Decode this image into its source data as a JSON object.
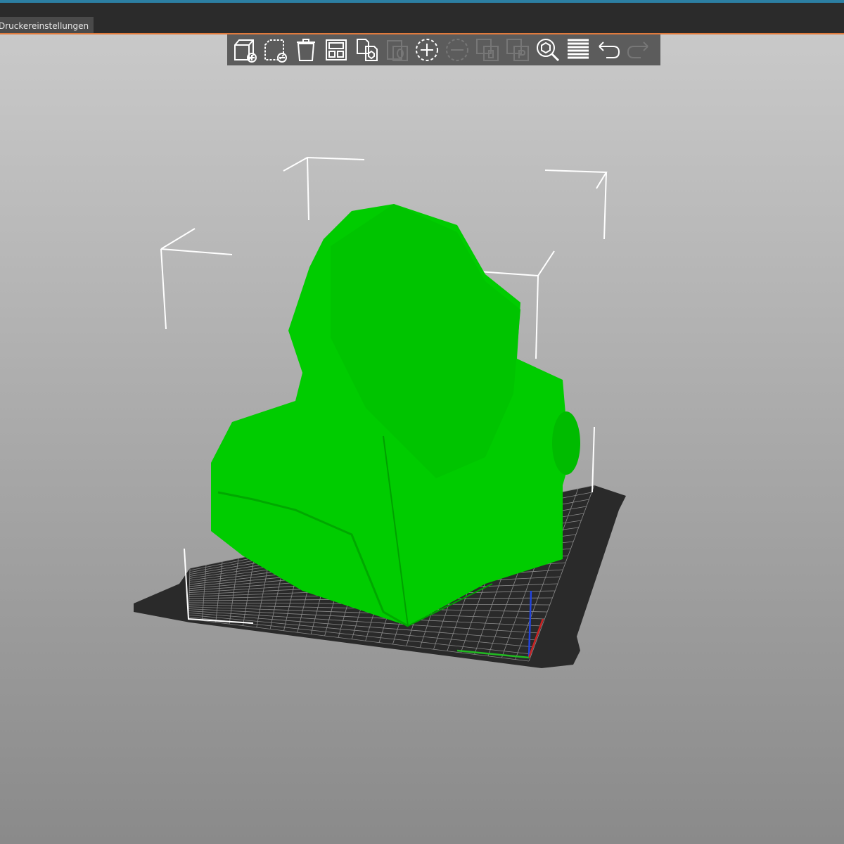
{
  "window": {
    "tab_label": "Druckereinstellungen"
  },
  "toolbar": {
    "buttons": [
      {
        "icon": "add-object-icon",
        "enabled": true
      },
      {
        "icon": "delete-object-icon",
        "enabled": true
      },
      {
        "icon": "delete-all-icon",
        "enabled": true
      },
      {
        "icon": "arrange-icon",
        "enabled": true
      },
      {
        "icon": "copy-icon",
        "enabled": true
      },
      {
        "icon": "paste-icon",
        "enabled": false
      },
      {
        "icon": "add-instance-icon",
        "enabled": true
      },
      {
        "icon": "remove-instance-icon",
        "enabled": false
      },
      {
        "icon": "split-to-objects-icon",
        "enabled": false
      },
      {
        "icon": "split-to-parts-icon",
        "enabled": false
      },
      {
        "icon": "search-icon",
        "enabled": true
      },
      {
        "icon": "layers-icon",
        "enabled": true
      },
      {
        "icon": "undo-icon",
        "enabled": true
      },
      {
        "icon": "redo-icon",
        "enabled": false
      }
    ]
  },
  "scene": {
    "model_color": "#00cc00",
    "bed_color": "#2a2a2a",
    "axis_colors": {
      "x": "#cc2222",
      "y": "#22bb22",
      "z": "#2244dd"
    }
  }
}
